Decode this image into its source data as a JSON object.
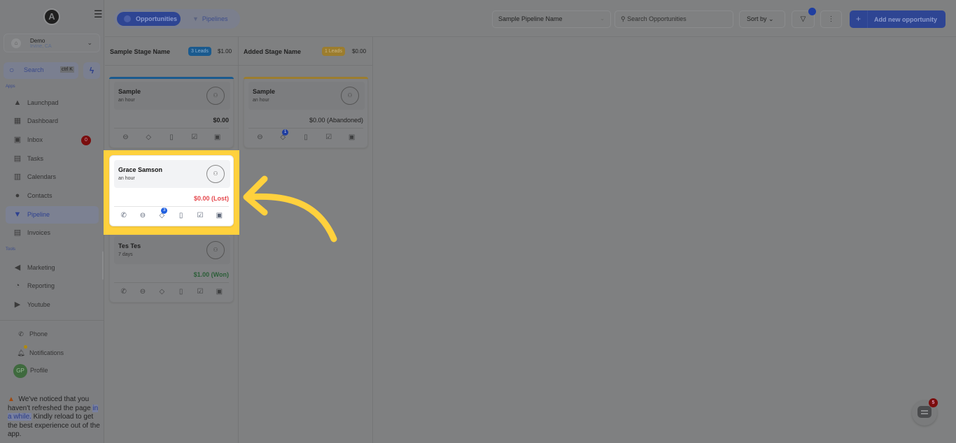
{
  "sidebar": {
    "logo": "A",
    "location": {
      "name": "Demo",
      "city": "Irvine, CA"
    },
    "search": {
      "label": "Search",
      "shortcut": "ctrl K"
    },
    "sections": {
      "apps": "Apps",
      "tools": "Tools"
    },
    "apps": [
      {
        "label": "Launchpad",
        "icon": "rocket-icon"
      },
      {
        "label": "Dashboard",
        "icon": "grid-icon"
      },
      {
        "label": "Inbox",
        "icon": "inbox-icon",
        "badge": "0"
      },
      {
        "label": "Tasks",
        "icon": "clipboard-icon"
      },
      {
        "label": "Calendars",
        "icon": "calendar-icon"
      },
      {
        "label": "Contacts",
        "icon": "person-icon"
      },
      {
        "label": "Pipeline",
        "icon": "funnel-icon",
        "active": true
      },
      {
        "label": "Invoices",
        "icon": "invoice-icon"
      }
    ],
    "tools": [
      {
        "label": "Marketing",
        "icon": "megaphone-icon"
      },
      {
        "label": "Reporting",
        "icon": "pie-chart-icon"
      },
      {
        "label": "Youtube",
        "icon": "youtube-icon"
      }
    ],
    "bottom": {
      "phone": "Phone",
      "notifications": "Notifications",
      "profile": "Profile",
      "profile_initials": "GP"
    },
    "notice": {
      "text_before": "We've noticed that you haven't refreshed the page ",
      "link": "in a while.",
      "text_after": " Kindly reload to get the best experience out of the app."
    }
  },
  "topbar": {
    "tabs": [
      {
        "label": "Opportunities",
        "active": true
      },
      {
        "label": "Pipelines"
      }
    ],
    "pipeline_select": "Sample Pipeline Name",
    "search_placeholder": "Search Opportunities",
    "sort_label": "Sort by",
    "add_label": "Add new opportunity"
  },
  "columns": [
    {
      "title": "Sample Stage Name",
      "leads": "3 Leads",
      "amount": "$1.00",
      "accent": "#1a5a8e",
      "cards": [
        {
          "name": "Sample",
          "time": "an hour",
          "amount": "$0.00",
          "status": "open"
        },
        {
          "name": "Grace Samson",
          "time": "an hour",
          "amount": "$0.00 (Lost)",
          "status": "lost",
          "tag_count": "3"
        },
        {
          "name": "Tes Tes",
          "time": "7 days",
          "amount": "$1.00 (Won)",
          "status": "won"
        }
      ]
    },
    {
      "title": "Added Stage Name",
      "leads": "1 Leads",
      "amount": "$0.00",
      "accent": "#9c7d2e",
      "cards": [
        {
          "name": "Sample",
          "time": "an hour",
          "amount": "$0.00 (Abandoned)",
          "status": "abandoned",
          "tag_count": "1"
        }
      ]
    }
  ],
  "colors": {
    "lost": "#e5484d",
    "won": "#2e8a4e",
    "highlight": "#ffd13d",
    "primary": "#2e4593"
  },
  "chat": {
    "unread": "5"
  }
}
